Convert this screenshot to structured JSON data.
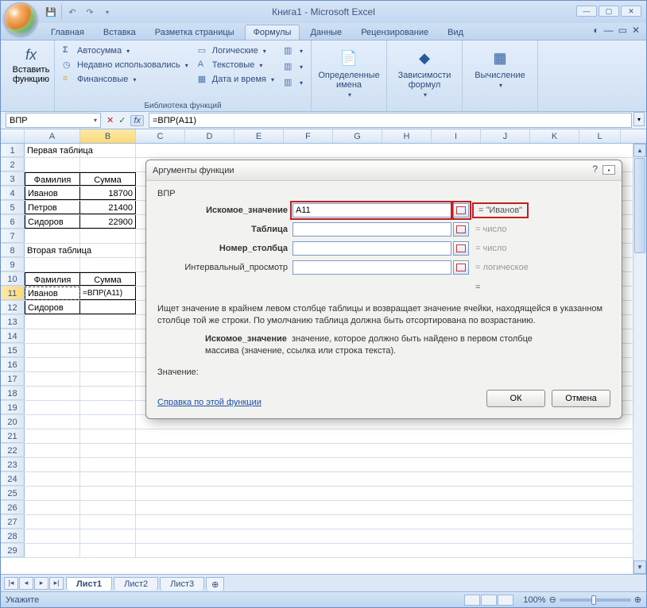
{
  "title": "Книга1 - Microsoft Excel",
  "qat": {
    "save": "save",
    "undo": "undo",
    "redo": "redo"
  },
  "tabs": {
    "items": [
      "Главная",
      "Вставка",
      "Разметка страницы",
      "Формулы",
      "Данные",
      "Рецензирование",
      "Вид"
    ],
    "active_index": 3
  },
  "ribbon": {
    "insert_fn": "Вставить функцию",
    "lib_label": "Библиотека функций",
    "autosum": "Автосумма",
    "recent": "Недавно использовались",
    "financial": "Финансовые",
    "logical": "Логические",
    "text": "Текстовые",
    "datetime": "Дата и время",
    "defined_names": "Определенные имена",
    "formula_auditing": "Зависимости формул",
    "calculation": "Вычисление"
  },
  "formula_bar": {
    "name_box": "ВПР",
    "formula": "=ВПР(A11)"
  },
  "columns": [
    "A",
    "B",
    "C",
    "D",
    "E",
    "F",
    "G",
    "H",
    "I",
    "J",
    "K",
    "L"
  ],
  "table1": {
    "title": "Первая таблица",
    "headers": [
      "Фамилия",
      "Сумма"
    ],
    "rows": [
      {
        "name": "Иванов",
        "value": "18700"
      },
      {
        "name": "Петров",
        "value": "21400"
      },
      {
        "name": "Сидоров",
        "value": "22900"
      }
    ]
  },
  "table2": {
    "title": "Вторая таблица",
    "headers": [
      "Фамилия",
      "Сумма"
    ],
    "rows": [
      {
        "name": "Иванов",
        "value": "=ВПР(A11)"
      },
      {
        "name": "Сидоров",
        "value": ""
      }
    ]
  },
  "sheets": {
    "items": [
      "Лист1",
      "Лист2",
      "Лист3"
    ],
    "active_index": 0
  },
  "status": {
    "mode": "Укажите",
    "zoom": "100%"
  },
  "dialog": {
    "title": "Аргументы функции",
    "fn": "ВПР",
    "args": [
      {
        "label": "Искомое_значение",
        "value": "A11",
        "result": "= \"Иванов\"",
        "highlight": true
      },
      {
        "label": "Таблица",
        "value": "",
        "result": "= число",
        "gray": true
      },
      {
        "label": "Номер_столбца",
        "value": "",
        "result": "= число",
        "gray": true
      },
      {
        "label": "Интервальный_просмотр",
        "value": "",
        "result": "= логическое",
        "gray": true
      }
    ],
    "eq_text": "=",
    "description": "Ищет значение в крайнем левом столбце таблицы и возвращает значение ячейки, находящейся в указанном столбце той же строки. По умолчанию таблица должна быть отсортирована по возрастанию.",
    "arg_desc_label": "Искомое_значение",
    "arg_desc_text": "значение, которое должно быть найдено в первом столбце массива (значение, ссылка или строка текста).",
    "value_label": "Значение:",
    "help_link": "Справка по этой функции",
    "ok": "ОК",
    "cancel": "Отмена"
  }
}
